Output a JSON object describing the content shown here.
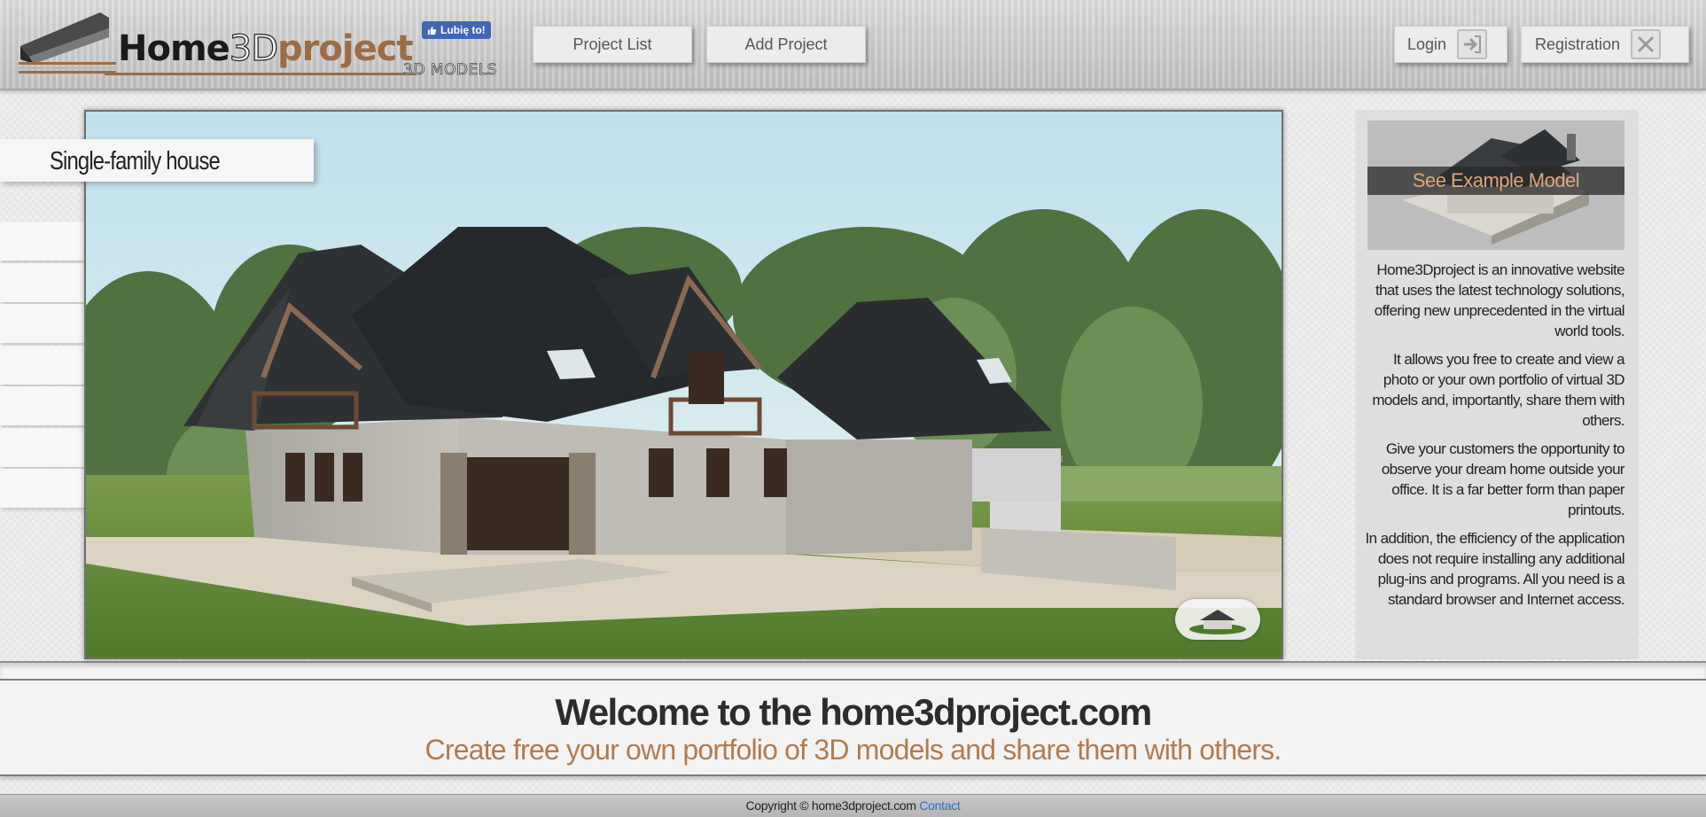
{
  "header": {
    "logo": {
      "part1": "Home",
      "part2": "3D",
      "part3": "project",
      "subtitle": "3D MODELS"
    },
    "fb_like": "Lubię to!",
    "nav": {
      "project_list": "Project List",
      "add_project": "Add Project"
    },
    "auth": {
      "login": "Login",
      "registration": "Registration"
    }
  },
  "main": {
    "title": "Single-family house",
    "example_label": "See Example Model",
    "intro": [
      "Home3Dproject is an innovative website that uses the latest technology solutions, offering new unprecedented in the virtual world tools.",
      "It allows you free to create and view a photo or your own portfolio of virtual 3D models and, importantly, share them with others.",
      "Give your customers the opportunity to observe your dream home outside your office. It is a far better form than paper printouts.",
      "In addition, the efficiency of the application does not require installing any additional plug-ins and programs. All you need is a standard browser and Internet access."
    ]
  },
  "welcome": {
    "title": "Welcome to the home3dproject.com",
    "subtitle": "Create free your own portfolio of 3D models and share them with others."
  },
  "footer": {
    "copyright": "Copyright © home3dproject.com",
    "contact": "Contact"
  },
  "colors": {
    "accent_brown": "#b07c50",
    "link_blue": "#2b6fcf",
    "facebook_blue": "#4267b2"
  }
}
